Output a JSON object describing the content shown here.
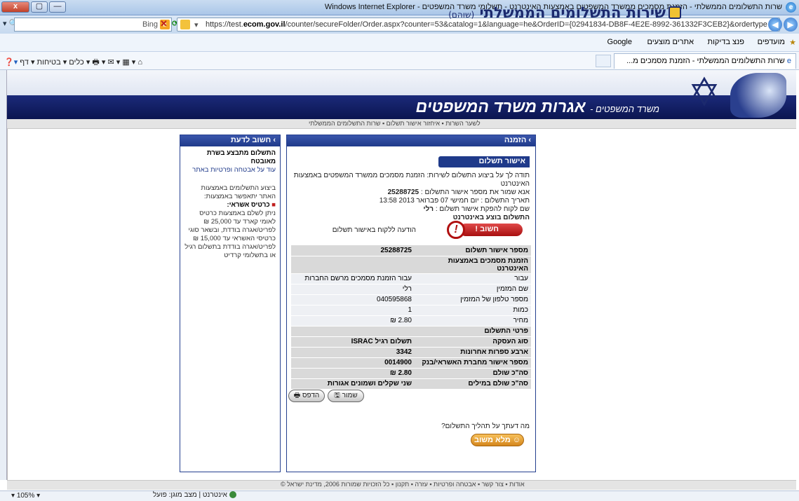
{
  "window": {
    "title": "שרות התשלומים הממשלתי - הזמנת מסמכים ממשרד המשפטים באמצעות האינטרנט - תשלומי משרד המשפטים - Windows Internet Explorer",
    "close": "x",
    "maximize": "▢",
    "minimize": "—"
  },
  "addressbar": {
    "url_prefix": "https://test.",
    "url_domain": "ecom.gov.il",
    "url_rest": "/counter/secureFolder/Order.aspx?counter=53&catalog=1&language=he&OrderID={02941834-DB8F-4E2E-8992-361332F3CEB2}&ordertype",
    "search_engine": "Bing",
    "search_placeholder": ""
  },
  "favorites": {
    "label": "מועדפים",
    "items": [
      "פנצ בדיקות",
      "אתרים מוצעים",
      "Google"
    ]
  },
  "tab": {
    "label": "שרות התשלומים הממשלתי - הזמנת מסמכים מ..."
  },
  "commandbar": {
    "items": [
      "כלים",
      "בטיחות",
      "דף"
    ]
  },
  "header": {
    "brand_title": "שירות התשלומים הממשלתי",
    "brand_sub": "(שוהם)",
    "ministry_prefix": "משרד המשפטים -",
    "ministry_title": "אגרות משרד המשפטים",
    "breadcrumb": "לשער השרות ▪ איחזור אישור תשלום ▪ שרות התשלומים הממשלתי"
  },
  "info_panel": {
    "title": "חשוב לדעת",
    "line1": "התשלום מתבצע בשרת מאובטח",
    "link1": "עוד על אבטחה ופרטיות באתר",
    "line2": "ביצוע התשלומים באמצעות האתר יתאפשר באמצעות:",
    "bullet": "כרטיס אשראי:",
    "line3": "ניתן לשלם באמצעות כרטיס לאומי קארד עד 25,000 ₪ לפריט/אגרה בודדת, ובשאר סוגי כרטיסי האשראי עד 15,000 ₪ לפריט/אגרה בודדת בתשלום רגיל או בתשלומי קרדיט"
  },
  "order_panel": {
    "title": "הזמנה",
    "confirm_title": "אישור תשלום",
    "thanks": "תודה לך על ביצוע התשלום לשירות: הזמנת מסמכים ממשרד המשפטים באמצעות האינטרנט",
    "keep_number_label": "אנא שמור את מספר אישור התשלום :",
    "keep_number_value": "25288725",
    "date_line": "תאריך התשלום : יום חמישי 07 פברואר 2013 13:58",
    "name_label": "שם לקוח להפקת אישור תשלום :",
    "name_value": "רלי",
    "done_line": "התשלום בוצע באינטרנט",
    "warn_label": "חשוב !",
    "warn_message": "הודעה ללקוח באישור תשלום",
    "rows": [
      {
        "label": "מספר אישור תשלום",
        "value": "25288725",
        "style": "g bold"
      },
      {
        "label": "הזמנת מסמכים באמצעות האינטרנט",
        "value": "",
        "style": "g bold"
      },
      {
        "label": "עבור",
        "value": "עבור הזמנת מסמכים מרשם החברות",
        "style": "w"
      },
      {
        "label": "שם המזמין",
        "value": "רלי",
        "style": "w"
      },
      {
        "label": "מספר טלפון של המזמין",
        "value": "040595868",
        "style": "w"
      },
      {
        "label": "כמות",
        "value": "1",
        "style": "w"
      },
      {
        "label": "מחיר",
        "value": "2.80 ₪",
        "style": "w"
      },
      {
        "label": "פרטי התשלום",
        "value": "",
        "style": "g bold"
      },
      {
        "label": "סוג העסקה",
        "value": "תשלום רגיל ISRAC",
        "style": "g bold"
      },
      {
        "label": "ארבע ספרות אחרונות",
        "value": "3342",
        "style": "g bold"
      },
      {
        "label": "מספר אישור מחברת האשראי/בנק",
        "value": "0014900",
        "style": "g bold"
      },
      {
        "label": "סה\"כ שולם",
        "value": "2.80 ₪",
        "style": "g bold"
      },
      {
        "label": "סה\"כ שולם במילים",
        "value": "שני שקלים ושמונים אגורות",
        "style": "g bold"
      }
    ],
    "save_label": "שמור",
    "print_label": "הדפס",
    "feedback_q": "מה דעתך על תהליך התשלום?",
    "feedback_btn": "מלא משוב"
  },
  "footer": {
    "text": "אודות ▪ צור קשר ▪ אבטחה ופרטיות ▪ עזרה ▪ תקנון ▪ כל הזכויות שמורות 2006, מדינת ישראל ©"
  },
  "statusbar": {
    "zone": "אינטרנט | מצב מוגן: פועל",
    "zoom": "105%"
  }
}
